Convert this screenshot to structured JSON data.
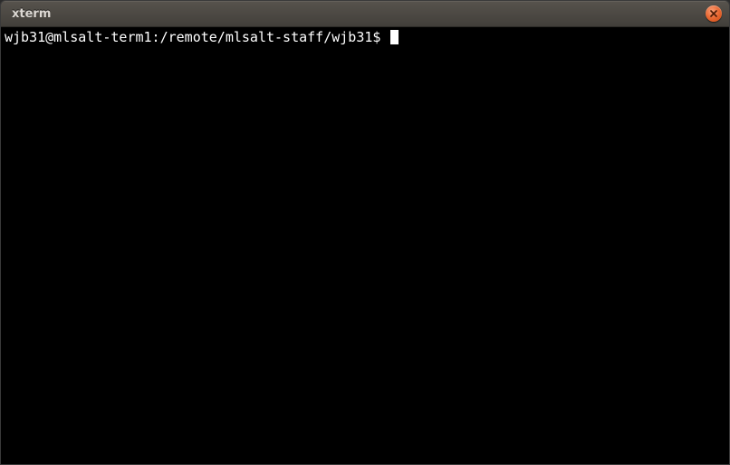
{
  "window": {
    "title": "xterm"
  },
  "terminal": {
    "prompt": "wjb31@mlsalt-term1:/remote/mlsalt-staff/wjb31$ "
  },
  "colors": {
    "close_button": "#e96a35",
    "titlebar_top": "#57534d",
    "titlebar_bottom": "#423f3a",
    "terminal_bg": "#000000",
    "terminal_fg": "#ffffff"
  }
}
